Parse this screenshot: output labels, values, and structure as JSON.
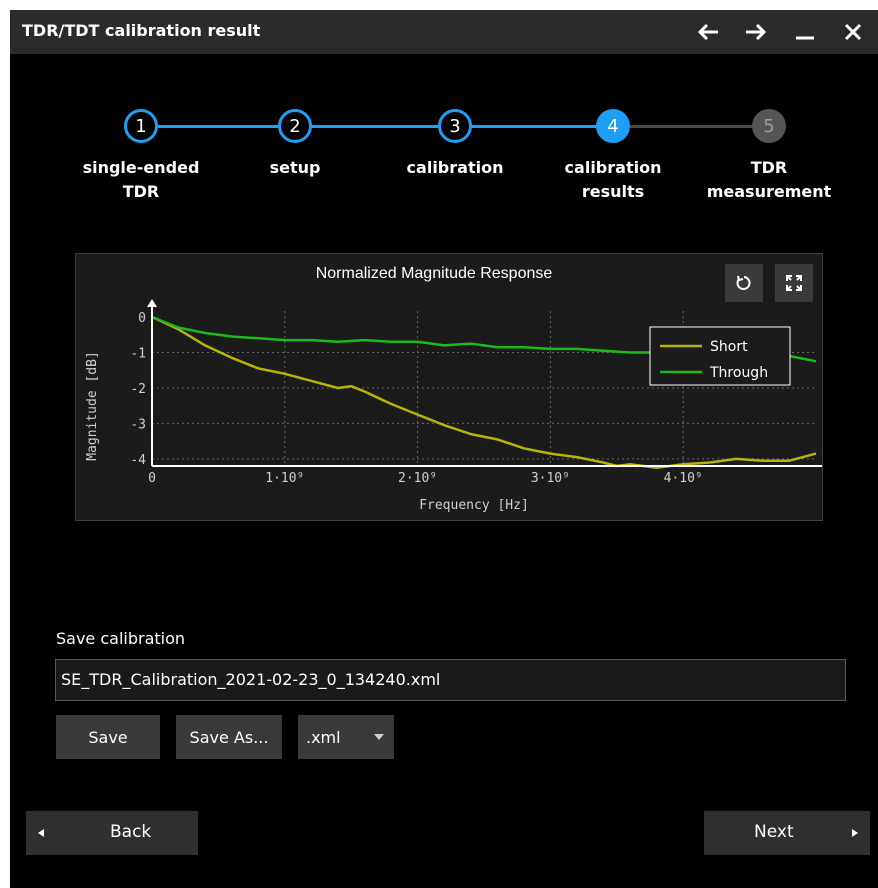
{
  "window": {
    "title": "TDR/TDT calibration result"
  },
  "titlebar_icons": [
    "back-arrow-icon",
    "forward-arrow-icon",
    "minimize-icon",
    "close-icon"
  ],
  "steps": [
    {
      "number": "1",
      "line1": "single-ended",
      "line2": "TDR",
      "state": "done"
    },
    {
      "number": "2",
      "line1": "setup",
      "line2": "",
      "state": "done"
    },
    {
      "number": "3",
      "line1": "calibration",
      "line2": "",
      "state": "done"
    },
    {
      "number": "4",
      "line1": "calibration",
      "line2": "results",
      "state": "active"
    },
    {
      "number": "5",
      "line1": "TDR",
      "line2": "measurement",
      "state": "pending"
    }
  ],
  "colors": {
    "accent": "#1e9ef5",
    "inactive": "#555555",
    "short": "#b8b20c",
    "through": "#1cb91c"
  },
  "chart_data": {
    "type": "line",
    "title": "Normalized Magnitude Response",
    "xlabel": "Frequency [Hz]",
    "ylabel": "Magnitude [dB]",
    "xlim": [
      0,
      5000000000
    ],
    "ylim": [
      -4.2,
      0
    ],
    "x_ticks": [
      0,
      1000000000,
      2000000000,
      3000000000,
      4000000000
    ],
    "x_tick_labels": [
      "0",
      "1·10⁹",
      "2·10⁹",
      "3·10⁹",
      "4·10⁹"
    ],
    "y_ticks": [
      0,
      -1,
      -2,
      -3,
      -4
    ],
    "y_tick_labels": [
      "0",
      "-1",
      "-2",
      "-3",
      "-4"
    ],
    "grid": true,
    "legend": "top-right",
    "series": [
      {
        "name": "Short",
        "color": "#b8b20c",
        "x": [
          0,
          200000000,
          400000000,
          600000000,
          800000000,
          1000000000,
          1200000000,
          1400000000,
          1500000000,
          1600000000,
          1800000000,
          2000000000,
          2200000000,
          2400000000,
          2600000000,
          2800000000,
          3000000000,
          3200000000,
          3400000000,
          3500000000,
          3600000000,
          3800000000,
          4000000000,
          4200000000,
          4400000000,
          4600000000,
          4800000000,
          5000000000
        ],
        "y": [
          0,
          -0.35,
          -0.8,
          -1.15,
          -1.45,
          -1.6,
          -1.8,
          -2.0,
          -1.95,
          -2.1,
          -2.45,
          -2.75,
          -3.05,
          -3.3,
          -3.45,
          -3.7,
          -3.85,
          -3.95,
          -4.1,
          -4.2,
          -4.15,
          -4.25,
          -4.15,
          -4.1,
          -4.0,
          -4.05,
          -4.05,
          -3.85
        ]
      },
      {
        "name": "Through",
        "color": "#1cb91c",
        "x": [
          0,
          200000000,
          400000000,
          600000000,
          800000000,
          1000000000,
          1200000000,
          1400000000,
          1600000000,
          1800000000,
          2000000000,
          2200000000,
          2400000000,
          2600000000,
          2800000000,
          3000000000,
          3200000000,
          3400000000,
          3600000000,
          3800000000,
          4000000000,
          4200000000,
          4400000000,
          4600000000,
          4800000000,
          5000000000
        ],
        "y": [
          0,
          -0.3,
          -0.45,
          -0.55,
          -0.6,
          -0.65,
          -0.65,
          -0.7,
          -0.65,
          -0.7,
          -0.7,
          -0.8,
          -0.75,
          -0.85,
          -0.85,
          -0.9,
          -0.9,
          -0.95,
          -1.0,
          -1.0,
          -1.0,
          -1.05,
          -1.05,
          -1.1,
          -1.1,
          -1.25
        ]
      }
    ]
  },
  "save": {
    "label": "Save calibration",
    "filename": "SE_TDR_Calibration_2021-02-23_0_134240.xml",
    "save_button": "Save",
    "save_as_button": "Save As...",
    "format_selected": ".xml"
  },
  "nav": {
    "back": "Back",
    "next": "Next"
  }
}
